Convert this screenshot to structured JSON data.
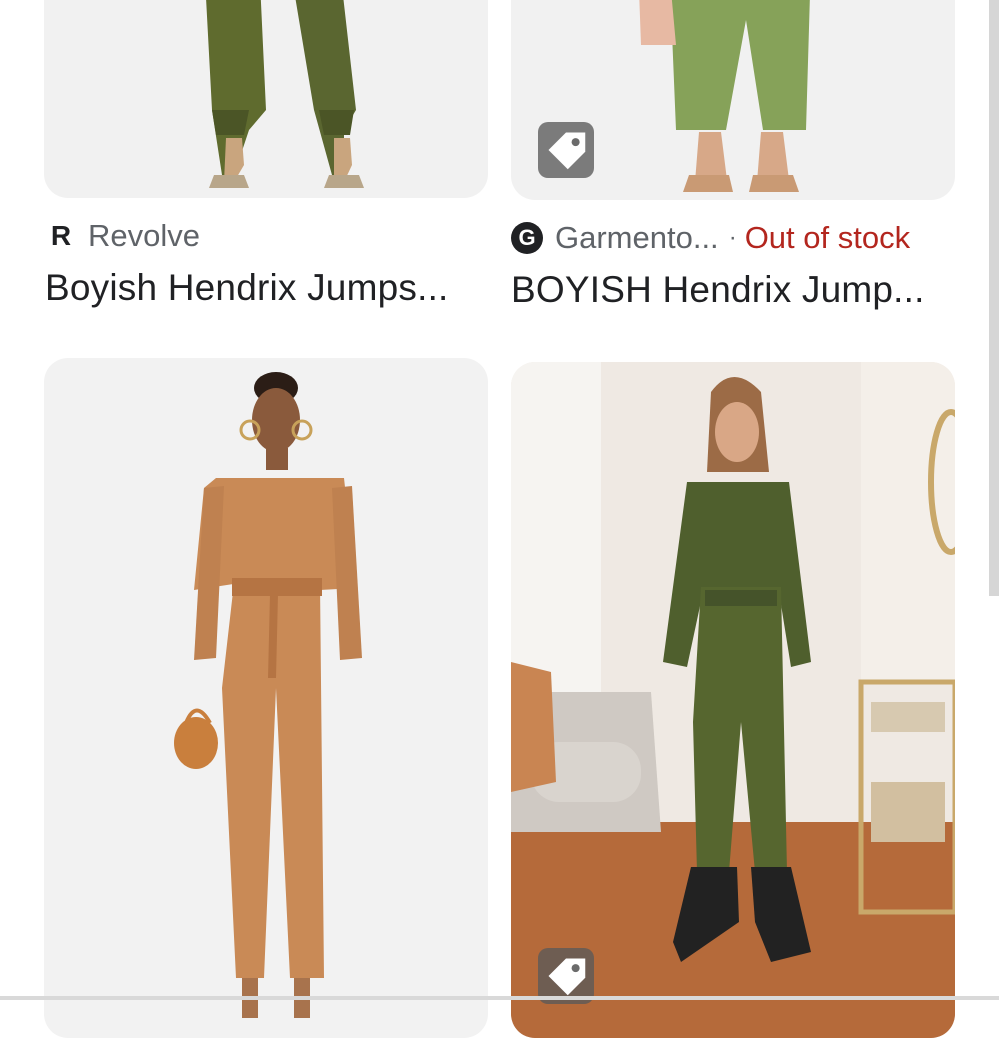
{
  "results": [
    {
      "image_alt": "Model in olive satin jogger jumpsuit with heels",
      "source": {
        "logo": "R",
        "logo_icon": "revolve-logo-icon",
        "name": "Revolve"
      },
      "title": "Boyish Hendrix Jumps..."
    },
    {
      "image_alt": "Model in green jumpsuit with pink handbag",
      "source": {
        "logo": "G",
        "logo_icon": "garmentory-logo-icon",
        "name": "Garmento...",
        "separator": "·",
        "stock_status": "Out of stock"
      },
      "title": "BOYISH Hendrix Jump...",
      "badge_icon": "shopping-tag-icon"
    },
    {
      "image_alt": "Model in caramel satin wrap jumpsuit holding woven bag"
    },
    {
      "image_alt": "Model in olive jumpsuit with combat boots in living room",
      "badge_icon": "shopping-tag-icon"
    }
  ],
  "colors": {
    "stock_status": "#b3261e",
    "title_text": "#202124",
    "source_text": "#5f6368"
  }
}
